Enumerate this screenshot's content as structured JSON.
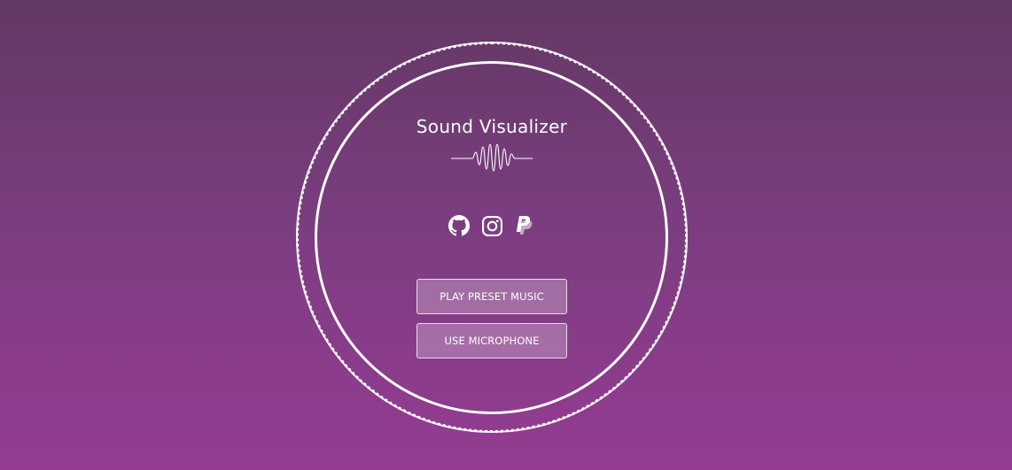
{
  "app": {
    "title": "Sound Visualizer"
  },
  "social": [
    {
      "icon": "github-icon"
    },
    {
      "icon": "instagram-icon"
    },
    {
      "icon": "paypal-icon"
    }
  ],
  "buttons": {
    "preset_label": "PLAY PRESET MUSIC",
    "mic_label": "USE MICROPHONE"
  },
  "colors": {
    "background_top": "#633863",
    "background_bottom": "#953c92",
    "foreground": "#ffffff"
  }
}
